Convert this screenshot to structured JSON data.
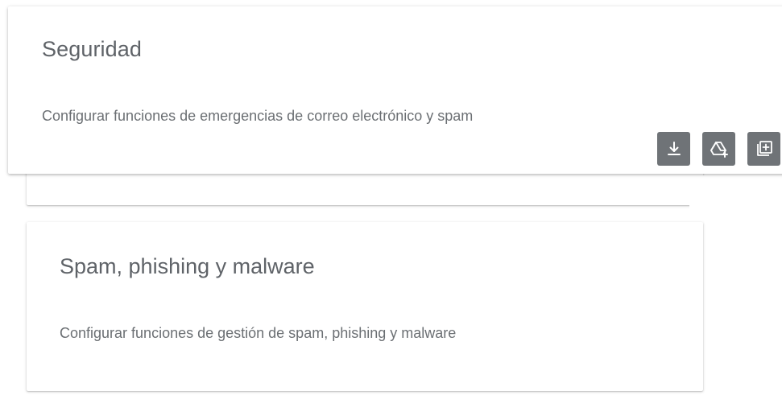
{
  "cards": [
    {
      "title": "Seguridad",
      "description": "Configurar funciones de emergencias de correo electrónico y spam"
    },
    {
      "title": "Spam, phishing y malware",
      "description": "Configurar funciones de gestión de spam, phishing y malware"
    }
  ],
  "actions": [
    {
      "icon": "download-icon"
    },
    {
      "icon": "drive-add-icon"
    },
    {
      "icon": "add-to-collection-icon"
    }
  ]
}
